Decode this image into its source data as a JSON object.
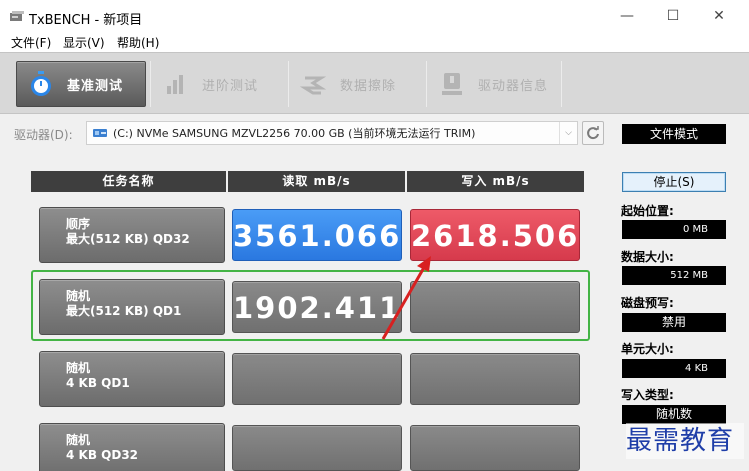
{
  "window": {
    "title": "TxBENCH - 新项目",
    "minimize_glyph": "—",
    "maximize_glyph": "☐",
    "close_glyph": "✕"
  },
  "menu": {
    "items": [
      {
        "label": "文件(F)"
      },
      {
        "label": "显示(V)"
      },
      {
        "label": "帮助(H)"
      }
    ]
  },
  "tabs": [
    {
      "label": "基准测试",
      "icon": "stopwatch-icon",
      "active": true
    },
    {
      "label": "进阶测试",
      "icon": "bar-chart-icon",
      "active": false
    },
    {
      "label": "数据擦除",
      "icon": "eraser-icon",
      "active": false
    },
    {
      "label": "驱动器信息",
      "icon": "drive-info-icon",
      "active": false
    }
  ],
  "drive": {
    "label": "驱动器(D):",
    "selected": "(C:) NVMe SAMSUNG MZVL2256  70.00 GB (当前环境无法运行 TRIM)",
    "mode": "文件模式"
  },
  "table": {
    "headers": [
      "任务名称",
      "读取 mB/s",
      "写入 mB/s"
    ],
    "rows": [
      {
        "line1": "顺序",
        "line2": "最大(512 KB) QD32",
        "read": "3561.066",
        "write": "2618.506"
      },
      {
        "line1": "随机",
        "line2": "最大(512 KB) QD1",
        "read": "1902.411",
        "write": ""
      },
      {
        "line1": "随机",
        "line2": "4 KB QD1",
        "read": "",
        "write": ""
      },
      {
        "line1": "随机",
        "line2": "4 KB QD32",
        "read": "",
        "write": ""
      }
    ]
  },
  "side": {
    "stop_label": "停止(S)",
    "start_pos_label": "起始位置:",
    "start_pos_value": "0 MB",
    "data_size_label": "数据大小:",
    "data_size_value": "512 MB",
    "precondition_label": "磁盘预写:",
    "precondition_value": "禁用",
    "unit_size_label": "单元大小:",
    "unit_size_value": "4 KB",
    "write_type_label": "写入类型:",
    "write_type_value": "随机数"
  },
  "watermark": "最需教育",
  "colors": {
    "read_highlight": "#3a8cf0",
    "write_highlight": "#e24a5a",
    "selection_outline": "#43b445",
    "annotation_arrow": "#d82020"
  }
}
